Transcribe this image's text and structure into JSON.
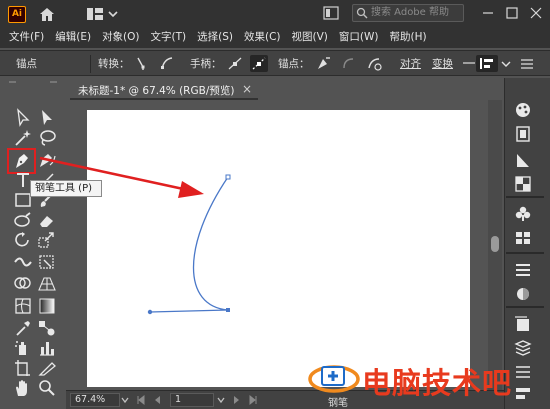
{
  "app": {
    "logo": "Ai"
  },
  "titlebar": {
    "search_placeholder": "搜索 Adobe 帮助"
  },
  "menu": [
    "文件(F)",
    "编辑(E)",
    "对象(O)",
    "文字(T)",
    "选择(S)",
    "效果(C)",
    "视图(V)",
    "窗口(W)",
    "帮助(H)"
  ],
  "controlbar": {
    "anchor_label": "锚点",
    "convert_label": "转换：",
    "handles_label": "手柄：",
    "anchors_label": "锚点：",
    "align_label": "对齐",
    "transform_label": "变换"
  },
  "document": {
    "tab_title": "未标题-1* @ 67.4% (RGB/预览)",
    "close_glyph": "×"
  },
  "tooltip": {
    "text": "钢笔工具 (P)"
  },
  "status": {
    "zoom": "67.4%",
    "page": "1",
    "tool": "钢笔"
  },
  "watermark": {
    "text": "电脑技术吧"
  },
  "colors": {
    "annotation_red": "#e02020",
    "path_blue": "#4a78c8",
    "watermark_red": "#e83a1e"
  },
  "icons": [
    "home-icon",
    "layout-icon",
    "search-icon",
    "pen-tool-icon",
    "selection-tool-icon",
    "direct-selection-icon",
    "hand-tool-icon",
    "zoom-tool-icon"
  ]
}
